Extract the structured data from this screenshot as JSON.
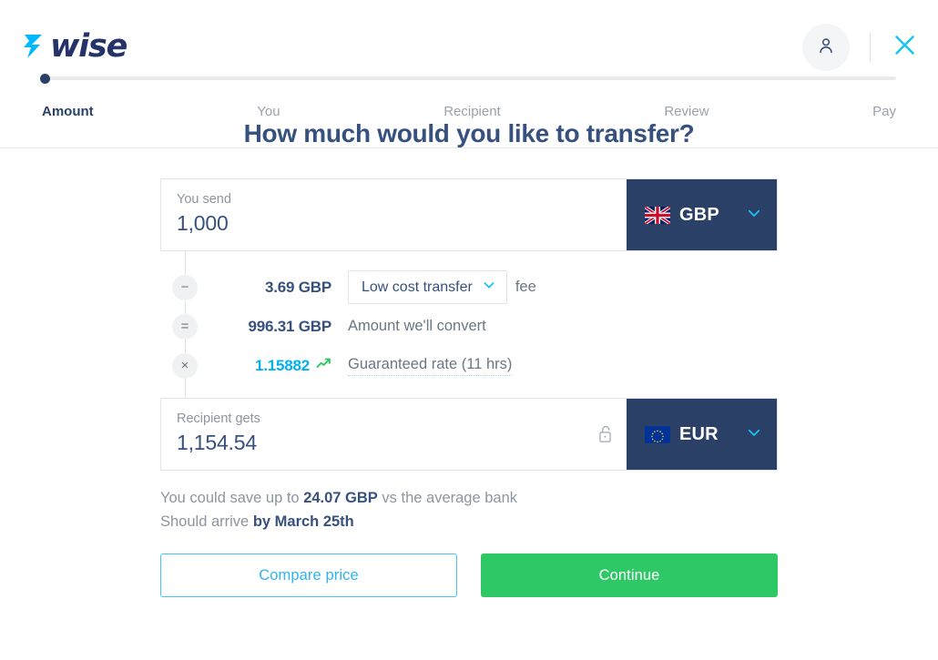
{
  "header": {
    "logo_word": "wise",
    "logo_mark_icon": "wise-arrow-icon",
    "avatar_icon": "person-icon",
    "close_icon": "close-x-icon"
  },
  "steps": {
    "items": [
      {
        "label": "Amount",
        "active": true
      },
      {
        "label": "You",
        "active": false
      },
      {
        "label": "Recipient",
        "active": false
      },
      {
        "label": "Review",
        "active": false
      },
      {
        "label": "Pay",
        "active": false
      }
    ]
  },
  "main": {
    "title": "How much would you like to transfer?"
  },
  "send": {
    "label": "You send",
    "value": "1,000",
    "currency": "GBP",
    "flag_icon": "gb-flag-icon",
    "chevron_icon": "chevron-down-icon"
  },
  "receive": {
    "label": "Recipient gets",
    "value": "1,154.54",
    "currency": "EUR",
    "flag_icon": "eu-flag-icon",
    "lock_icon": "unlocked-padlock-icon",
    "chevron_icon": "chevron-down-icon"
  },
  "breakdown": {
    "rows": [
      {
        "operator": "−",
        "operator_name": "minus",
        "amount": "3.69 GBP",
        "select_label": "Low cost transfer",
        "suffix": "fee"
      },
      {
        "operator": "=",
        "operator_name": "equals",
        "amount": "996.31 GBP",
        "description": "Amount we'll convert"
      },
      {
        "operator": "×",
        "operator_name": "multiply",
        "amount": "1.15882",
        "trend_icon": "trending-up-icon",
        "description": "Guaranteed rate (11 hrs)"
      }
    ]
  },
  "notes": {
    "save_prefix": "You could save up to ",
    "save_amount": "24.07 GBP",
    "save_suffix": " vs the average bank",
    "arrive_prefix": "Should arrive ",
    "arrive_date": "by March 25th"
  },
  "actions": {
    "compare_label": "Compare price",
    "continue_label": "Continue"
  },
  "colors": {
    "navy": "#2b4066",
    "text_navy": "#37517e",
    "cyan": "#00b0ef",
    "green": "#2ec866",
    "gray": "#8d95a0"
  }
}
